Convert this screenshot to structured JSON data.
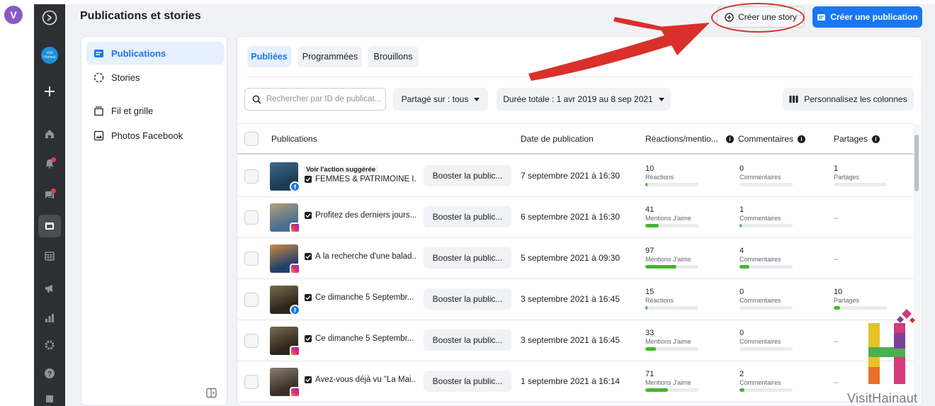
{
  "profile": {
    "initial": "V"
  },
  "rail": {
    "brand_text": "Visit Hainaut"
  },
  "page": {
    "title": "Publications et stories"
  },
  "header_actions": {
    "story_label": "Créer une story",
    "publish_label": "Créer une publication"
  },
  "sidebar": {
    "items": [
      {
        "label": "Publications",
        "icon": "publications-icon",
        "active": true
      },
      {
        "label": "Stories",
        "icon": "stories-icon",
        "active": false
      },
      {
        "label": "Fil et grille",
        "icon": "feed-grid-icon",
        "active": false
      },
      {
        "label": "Photos Facebook",
        "icon": "photos-icon",
        "active": false
      }
    ]
  },
  "tabs": [
    {
      "label": "Publiées",
      "active": true
    },
    {
      "label": "Programmées",
      "active": false
    },
    {
      "label": "Brouillons",
      "active": false
    }
  ],
  "filters": {
    "search_placeholder": "Rechercher par ID de publicat...",
    "shared_on": "Partagé sur : tous",
    "duration": "Durée totale : 1 avr 2019 au 8 sep 2021",
    "customize": "Personnalisez les colonnes"
  },
  "table": {
    "headers": {
      "publications": "Publications",
      "date": "Date de publication",
      "reactions": "Réactions/mentio...",
      "comments": "Commentaires",
      "shares": "Partages"
    },
    "boost_label": "Booster la public...",
    "rows": [
      {
        "suggested": "Voir l'action suggérée",
        "title": "FEMMES & PATRIMOINE I...",
        "platform": "facebook",
        "date": "7 septembre 2021 à 16:30",
        "reactions": {
          "value": "10",
          "label": "Réactions",
          "fill": 0.03
        },
        "comments": {
          "value": "0",
          "label": "Commentaires",
          "fill": 0
        },
        "shares": {
          "value": "1",
          "label": "Partages",
          "fill": 0
        }
      },
      {
        "suggested": "",
        "title": "Profitez des derniers jours...",
        "platform": "instagram",
        "date": "6 septembre 2021 à 16:30",
        "reactions": {
          "value": "41",
          "label": "Mentions J'aime",
          "fill": 0.25
        },
        "comments": {
          "value": "1",
          "label": "Commentaires",
          "fill": 0.04
        },
        "shares": {
          "value": "–"
        }
      },
      {
        "suggested": "",
        "title": "À la recherche d'une balad...",
        "platform": "instagram",
        "date": "5 septembre 2021 à 09:30",
        "reactions": {
          "value": "97",
          "label": "Mentions J'aime",
          "fill": 0.58
        },
        "comments": {
          "value": "4",
          "label": "Commentaires",
          "fill": 0.18
        },
        "shares": {
          "value": "–"
        }
      },
      {
        "suggested": "",
        "title": "Ce dimanche 5 Septembr...",
        "platform": "facebook",
        "date": "3 septembre 2021 à 16:45",
        "reactions": {
          "value": "15",
          "label": "Réactions",
          "fill": 0.03
        },
        "comments": {
          "value": "0",
          "label": "Commentaires",
          "fill": 0
        },
        "shares": {
          "value": "10",
          "label": "Partages",
          "fill": 0.12
        }
      },
      {
        "suggested": "",
        "title": "Ce dimanche 5 Septembr...",
        "platform": "instagram",
        "date": "3 septembre 2021 à 16:45",
        "reactions": {
          "value": "33",
          "label": "Mentions J'aime",
          "fill": 0.2
        },
        "comments": {
          "value": "0",
          "label": "Commentaires",
          "fill": 0
        },
        "shares": {
          "value": "–"
        }
      },
      {
        "suggested": "",
        "title": "Avez-vous déjà vu \"La Mai...",
        "platform": "instagram",
        "date": "1 septembre 2021 à 16:14",
        "reactions": {
          "value": "71",
          "label": "Mentions J'aime",
          "fill": 0.42
        },
        "comments": {
          "value": "2",
          "label": "Commentaires",
          "fill": 0.09
        },
        "shares": {
          "value": "–"
        }
      }
    ]
  },
  "watermark": {
    "text": "VisitHainaut"
  },
  "colors": {
    "accent": "#1877f2",
    "annotation": "#d9302c",
    "metric_bar": "#42b72a",
    "rail": "#2d2f33"
  }
}
